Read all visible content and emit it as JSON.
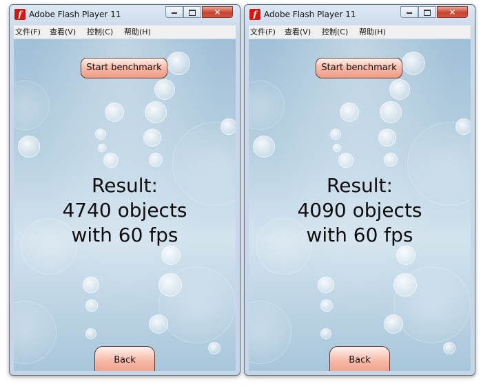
{
  "windows": [
    {
      "title": "Adobe Flash Player 11",
      "menu": [
        "文件(F)",
        "查看(V)",
        "控制(C)",
        "帮助(H)"
      ],
      "start_button": "Start benchmark",
      "result_line1": "Result:",
      "result_line2": "4740 objects",
      "result_line3": "with 60 fps",
      "back_button": "Back"
    },
    {
      "title": "Adobe Flash Player 11",
      "menu": [
        "文件(F)",
        "查看(V)",
        "控制(C)",
        "帮助(H)"
      ],
      "start_button": "Start benchmark",
      "result_line1": "Result:",
      "result_line2": "4090 objects",
      "result_line3": "with 60 fps",
      "back_button": "Back"
    }
  ],
  "icons": {
    "app": "flash-player-icon",
    "minimize": "minimize-icon",
    "maximize": "maximize-icon",
    "close": "close-icon"
  },
  "colors": {
    "button_fill": "#f7b9a6",
    "close_button": "#c7442f",
    "background": "#b8d1e2"
  }
}
